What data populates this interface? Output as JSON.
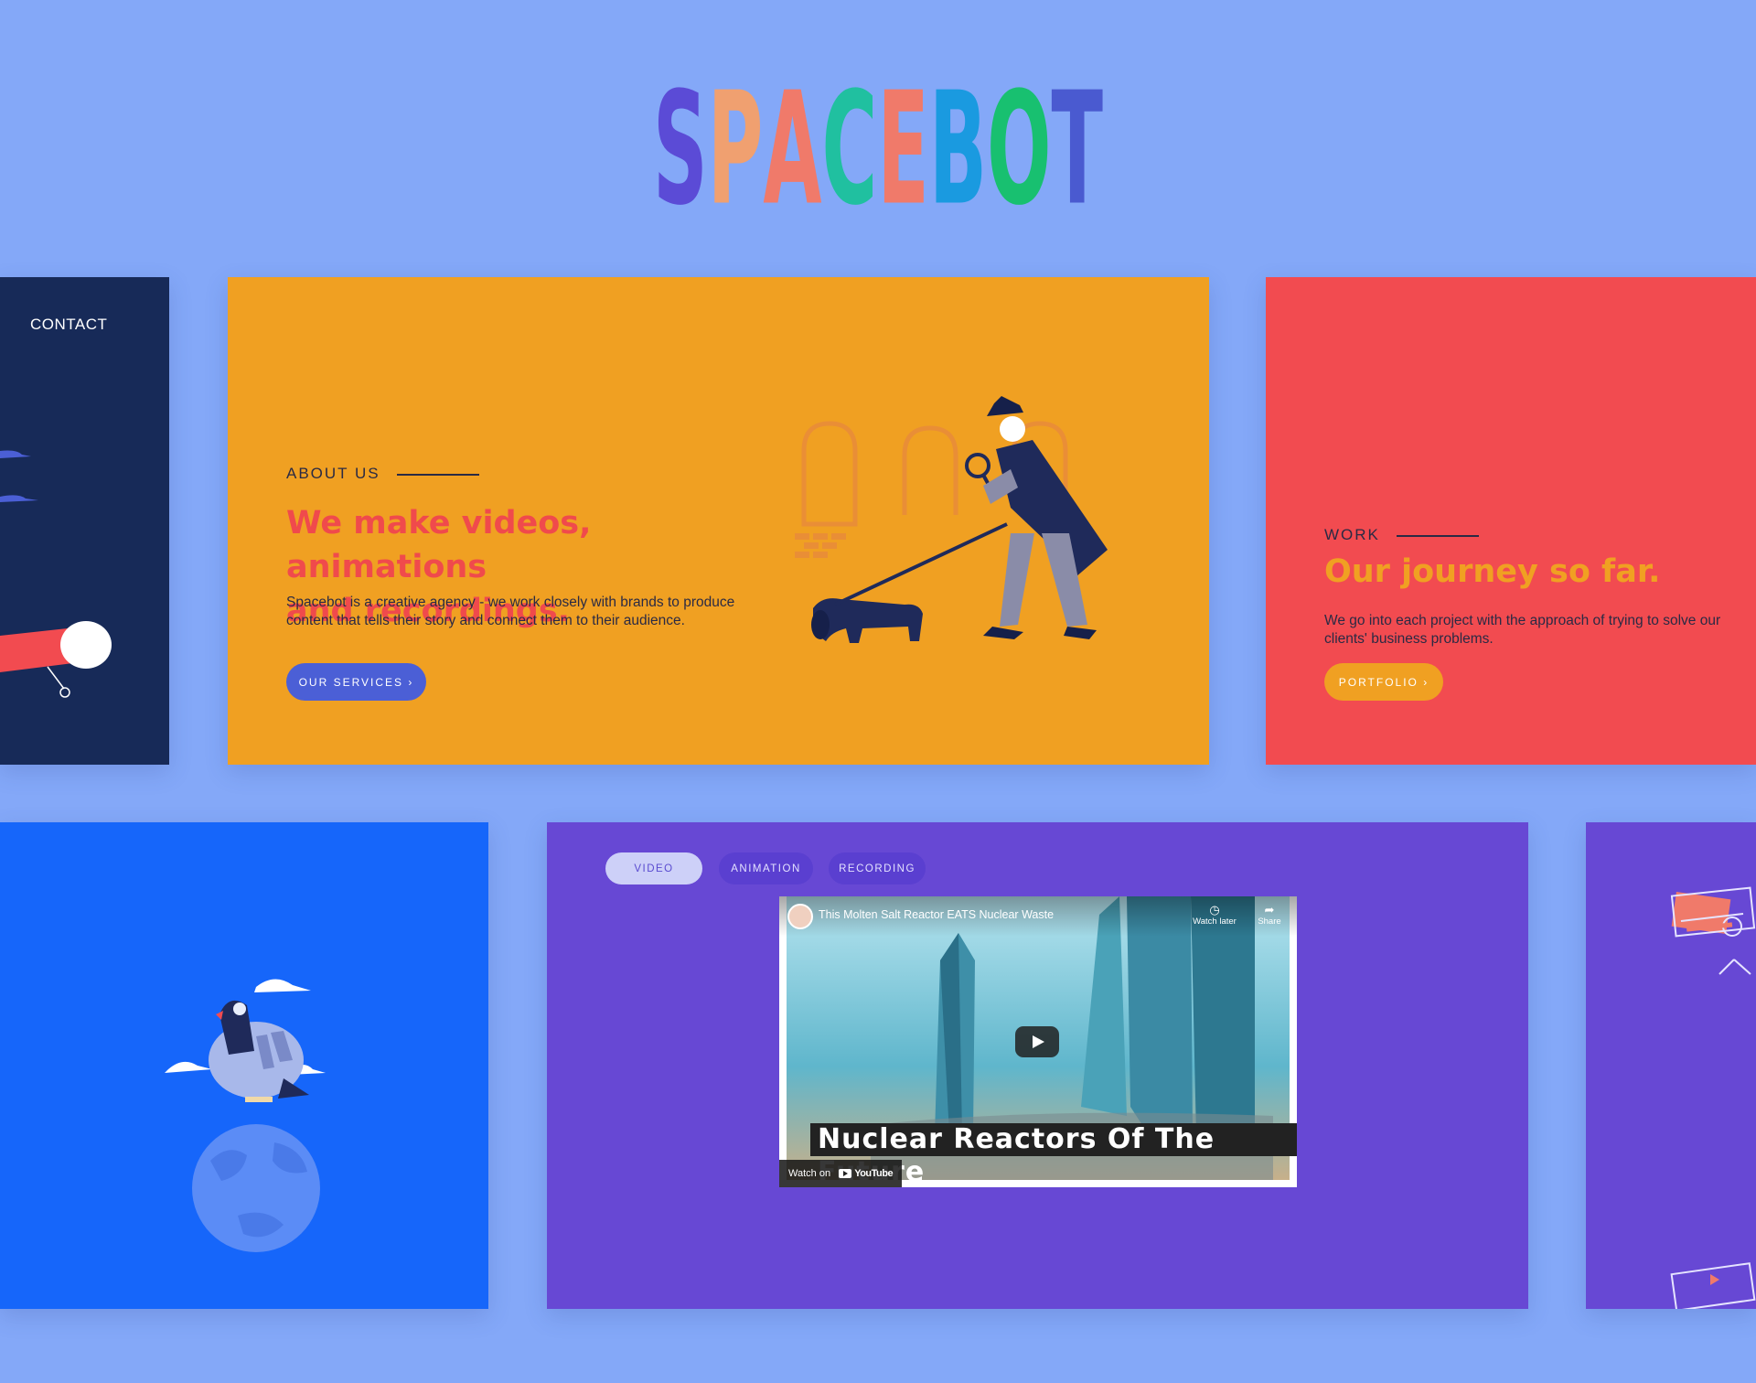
{
  "logo": {
    "text": "SPACEBOT",
    "letter_colors": [
      "#5b4bd6",
      "#f0a070",
      "#f07a6a",
      "#20c0a0",
      "#f07a6a",
      "#1a9ae0",
      "#18c070",
      "#4a5ad0"
    ]
  },
  "contact_card": {
    "nav_label": "CONTACT"
  },
  "about": {
    "eyebrow": "ABOUT US",
    "headline_line1": "We make videos, animations",
    "headline_line2": "and recordings.",
    "description": "Spacebot is a creative agency - we work closely with brands to produce content that tells their story and connect them to their audience.",
    "button_label": "OUR SERVICES ›"
  },
  "work": {
    "eyebrow": "WORK",
    "headline": "Our journey so far.",
    "description": "We go into each project with the approach of trying to solve our clients' business problems.",
    "button_label": "PORTFOLIO ›"
  },
  "video_section": {
    "tabs": [
      {
        "label": "VIDEO",
        "active": true
      },
      {
        "label": "ANIMATION",
        "active": false
      },
      {
        "label": "RECORDING",
        "active": false
      }
    ],
    "video": {
      "title": "This Molten Salt Reactor EATS Nuclear Waste",
      "watch_later": "Watch later",
      "share": "Share",
      "caption": "Nuclear Reactors Of The Future",
      "watch_on": "Watch on",
      "brand": "YouTube"
    }
  },
  "colors": {
    "background": "#84a8f8",
    "contact_card": "#172a58",
    "about_card": "#f0a022",
    "work_card": "#f24b50",
    "pigeon_card": "#1666fa",
    "video_card": "#6748d4",
    "accent_blue_button": "#4b5fd6",
    "headline_red": "#f04a4c",
    "headline_orange": "#f0a022"
  }
}
